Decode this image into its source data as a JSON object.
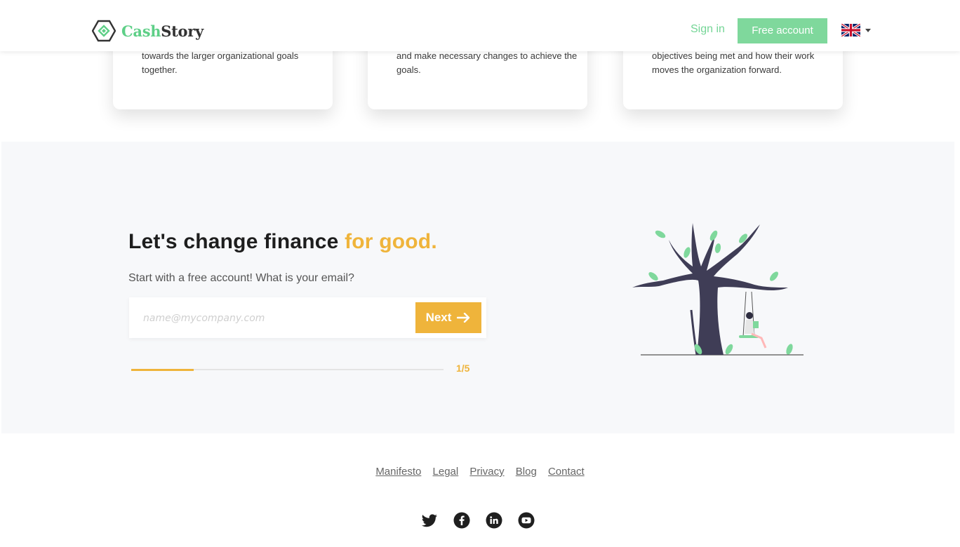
{
  "cards": [
    {
      "text": "towards the larger organizational goals together."
    },
    {
      "text": "and make necessary changes to achieve the goals."
    },
    {
      "text": "objectives being met and how their work moves the organization forward."
    }
  ],
  "header": {
    "logo_cash": "Cash",
    "logo_story": "Story",
    "signin_label": "Sign in",
    "free_account_label": "Free account",
    "language_icon": "uk-flag-icon"
  },
  "signup": {
    "headline_main": "Let's change finance ",
    "headline_accent": "for good.",
    "subline": "Start with a free account! What is your email?",
    "email_placeholder": "name@mycompany.com",
    "email_value": "",
    "next_label": "Next",
    "progress_text": "1/5",
    "progress_fraction": 0.2
  },
  "footer": {
    "links": [
      "Manifesto",
      "Legal",
      "Privacy",
      "Blog",
      "Contact"
    ],
    "social_icons": [
      "twitter-icon",
      "facebook-icon",
      "linkedin-icon",
      "youtube-icon"
    ]
  },
  "colors": {
    "brand_green": "#5ecf87",
    "button_green": "#7fd89c",
    "accent_orange": "#efb43b"
  }
}
